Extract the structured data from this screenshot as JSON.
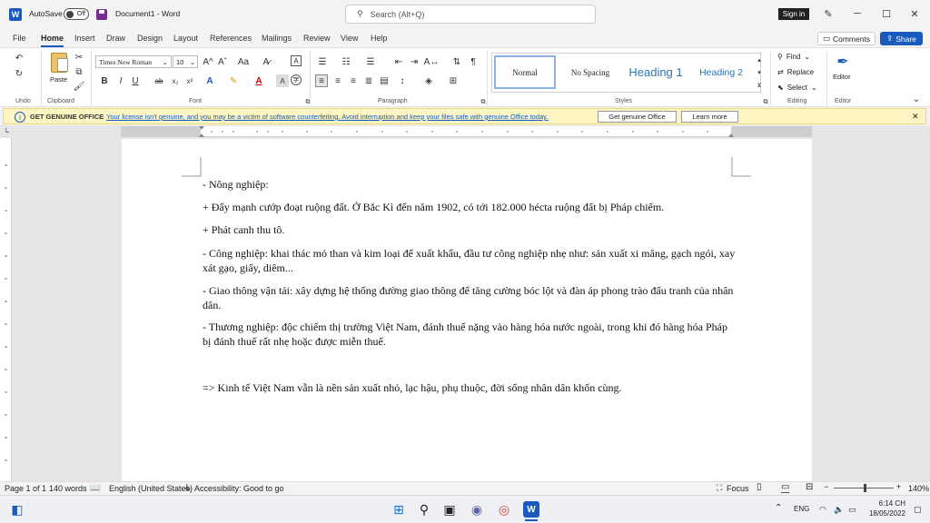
{
  "titlebar": {
    "autosave_label": "AutoSave",
    "autosave_state": "Off",
    "document_title": "Document1 - Word",
    "search_placeholder": "Search (Alt+Q)",
    "signin_label": "Sign in"
  },
  "tabs": [
    "File",
    "Home",
    "Insert",
    "Draw",
    "Design",
    "Layout",
    "References",
    "Mailings",
    "Review",
    "View",
    "Help"
  ],
  "active_tab": "Home",
  "actions": {
    "comments": "Comments",
    "share": "Share"
  },
  "ribbon": {
    "undo_label": "Undo",
    "clipboard_label": "Clipboard",
    "paste_label": "Paste",
    "font_label": "Font",
    "paragraph_label": "Paragraph",
    "styles_label": "Styles",
    "editing_label": "Editing",
    "editor_group_label": "Editor",
    "font_name": "Times New Roman",
    "font_size": "10",
    "styles": [
      "Normal",
      "No Spacing",
      "Heading 1",
      "Heading 2"
    ],
    "find_label": "Find",
    "replace_label": "Replace",
    "select_label": "Select",
    "editor_label": "Editor",
    "bold": "B",
    "italic": "I",
    "underline": "U",
    "strike": "ab",
    "sub": "x₂",
    "sup": "x²",
    "grow": "A^",
    "shrink": "Aˇ",
    "case": "Aa",
    "pilcrow": "¶"
  },
  "infobar": {
    "title": "GET GENUINE OFFICE",
    "message": "Your license isn't genuine, and you may be a victim of software counterfeiting. Avoid interruption and keep your files safe with genuine Office today.",
    "get_button": "Get genuine Office",
    "learn_button": "Learn more"
  },
  "document": {
    "paragraphs": [
      "- Nông nghiệp:",
      "+ Đẩy mạnh cướp đoạt ruộng đất. Ở Bắc Kì đến năm 1902, có tới 182.000 hécta ruộng đất bị Pháp chiếm.",
      "+ Phát canh thu tô.",
      "- Công nghiệp: khai thác mỏ than và kim loại để xuất khẩu, đầu tư công nghiệp nhẹ như: sản xuất xi măng, gạch ngói, xay xát gạo, giấy, diêm...",
      "- Giao thông vận tải: xây dựng hệ thống đường giao thông để tăng cường bóc lột và đàn áp phong trào đấu tranh của nhân dân.",
      "- Thương nghiệp: độc chiếm thị trường Việt Nam, đánh thuế nặng vào hàng hóa nước ngoài, trong khi đó hàng hóa Pháp bị đánh thuế rất nhẹ hoặc được miễn thuế.",
      "=> Kinh tế Việt Nam vẫn là nền sản xuất nhỏ, lạc hậu, phụ thuộc, đời sống nhân dân khốn cùng."
    ]
  },
  "statusbar": {
    "page": "Page 1 of 1",
    "words": "140 words",
    "language": "English (United States)",
    "accessibility": "Accessibility: Good to go",
    "focus": "Focus",
    "zoom": "140%"
  },
  "taskbar": {
    "language": "ENG",
    "time": "6:14 CH",
    "date": "18/05/2022"
  },
  "colors": {
    "accent": "#185abd",
    "infobar": "#fdf6c3",
    "heading": "#2e74b5"
  }
}
